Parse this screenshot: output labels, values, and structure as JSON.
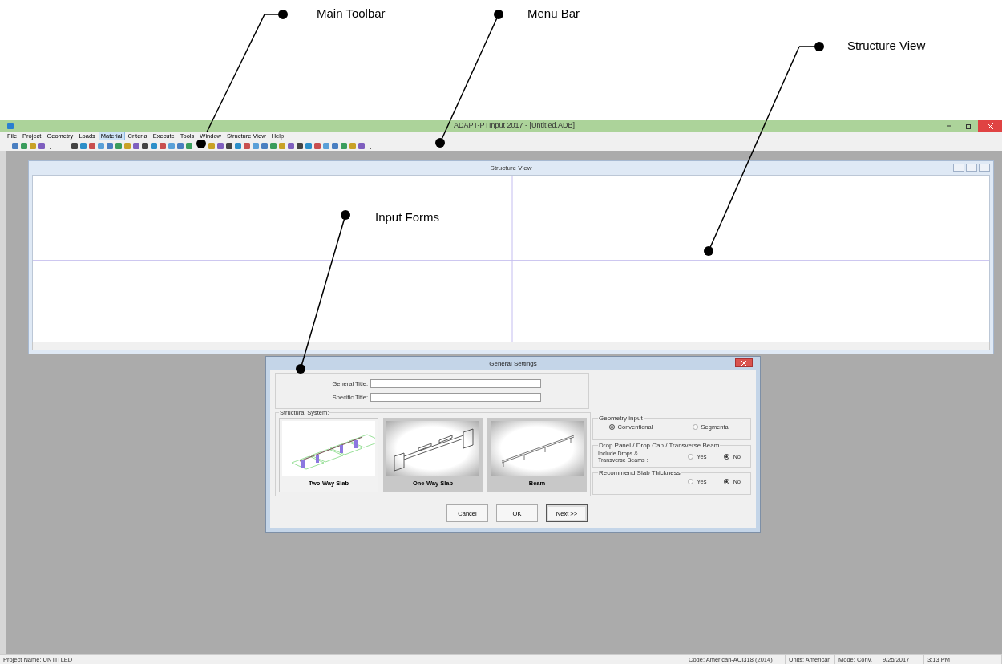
{
  "annotations": [
    {
      "label": "Main Toolbar"
    },
    {
      "label": "Menu Bar"
    },
    {
      "label": "Structure View"
    },
    {
      "label": "Input Forms"
    }
  ],
  "window": {
    "title": "ADAPT-PTInput 2017 - [Untitled.ADB]"
  },
  "menu": [
    {
      "label": "File",
      "selected": false
    },
    {
      "label": "Project",
      "selected": false
    },
    {
      "label": "Geometry",
      "selected": false
    },
    {
      "label": "Loads",
      "selected": false
    },
    {
      "label": "Material",
      "selected": true
    },
    {
      "label": "Criteria",
      "selected": false
    },
    {
      "label": "Execute",
      "selected": false
    },
    {
      "label": "Tools",
      "selected": false
    },
    {
      "label": "Window",
      "selected": false
    },
    {
      "label": "Structure View",
      "selected": false
    },
    {
      "label": "Help",
      "selected": false
    }
  ],
  "structure_view": {
    "title": "Structure View"
  },
  "dialog": {
    "title": "General Settings",
    "fields": [
      {
        "label": "General Title:"
      },
      {
        "label": "Specific Title:"
      }
    ],
    "structural_system": {
      "title": "Structural System:",
      "options": [
        {
          "kind": "two-way",
          "label": "Two-Way Slab",
          "selected": true
        },
        {
          "kind": "one-way",
          "label": "One-Way Slab",
          "selected": false
        },
        {
          "kind": "beam",
          "label": "Beam",
          "selected": false
        }
      ]
    },
    "groups": [
      {
        "title": "Geometry input",
        "options": [
          {
            "label": "Conventional",
            "selected": true
          },
          {
            "label": "Segmental",
            "selected": false
          }
        ]
      },
      {
        "title": "Drop Panel / Drop Cap / Transverse Beam",
        "prompt": "Include Drops & Transverse Beams :",
        "options": [
          {
            "label": "Yes",
            "selected": false
          },
          {
            "label": "No",
            "selected": true
          }
        ]
      },
      {
        "title": "Recommend Slab Thickness",
        "options": [
          {
            "label": "Yes",
            "selected": false
          },
          {
            "label": "No",
            "selected": true
          }
        ]
      }
    ],
    "buttons": [
      {
        "label": "Cancel",
        "default": false
      },
      {
        "label": "OK",
        "default": false
      },
      {
        "label": "Next >>",
        "default": true
      }
    ]
  },
  "status_bar": [
    "Project Name: UNTITLED",
    "Code: American-ACI318 (2014)",
    "Units: American",
    "Mode: Conv.",
    "9/25/2017",
    "3:13 PM"
  ]
}
